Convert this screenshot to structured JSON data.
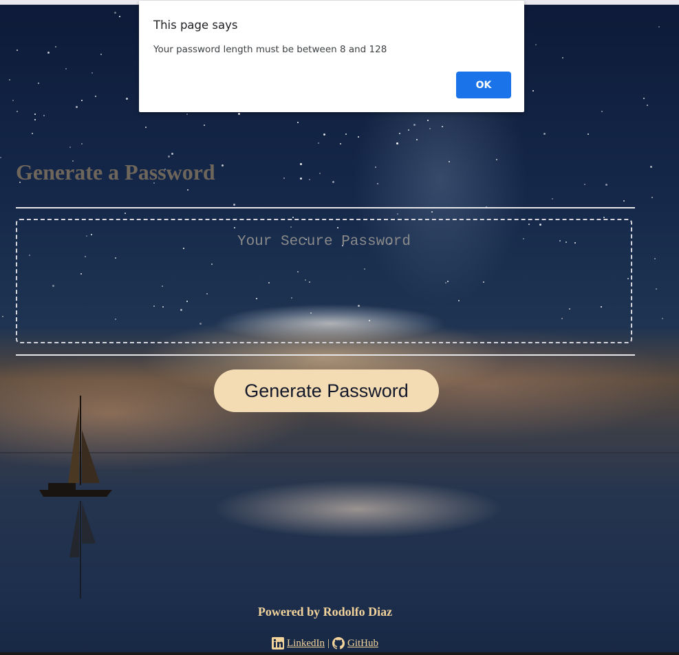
{
  "page": {
    "title": "Generate a Password",
    "password_placeholder": "Your Secure Password",
    "generate_button_label": "Generate Password"
  },
  "footer": {
    "powered_by": "Powered by Rodolfo Diaz",
    "linkedin_label": "LinkedIn",
    "separator": "|",
    "github_label": "GitHub"
  },
  "alert": {
    "title": "This page says",
    "message": "Your password length must be between 8 and 128",
    "ok_label": "OK"
  },
  "icons": {
    "linkedin": "linkedin-icon",
    "github": "github-icon"
  },
  "colors": {
    "accent": "#f3dcb3",
    "footer_text": "#f3d39c",
    "title_text": "#6f665b",
    "ok_button": "#1a73e8"
  }
}
